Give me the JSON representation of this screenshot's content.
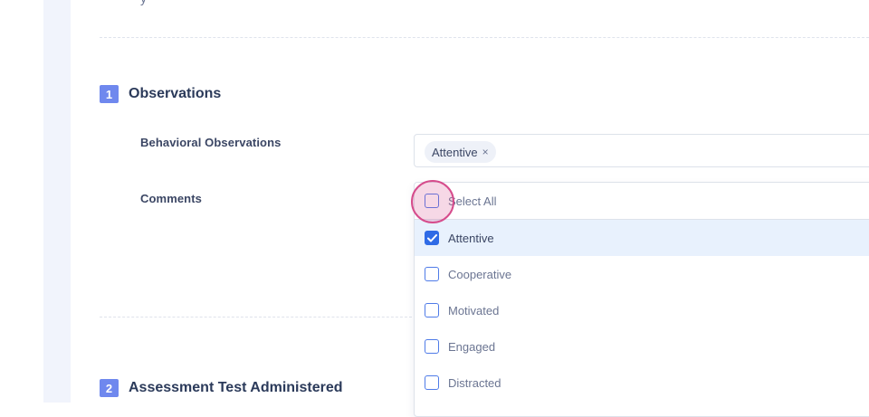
{
  "top_cut_text": "y",
  "sections": [
    {
      "number": "1",
      "title": "Observations"
    },
    {
      "number": "2",
      "title": "Assessment Test Administered"
    }
  ],
  "fields": {
    "behavioral_label": "Behavioral Observations",
    "comments_label": "Comments"
  },
  "multiselect": {
    "selected_chips": [
      "Attentive"
    ],
    "chip_remove_glyph": "×"
  },
  "dropdown": {
    "select_all_label": "Select All",
    "options": [
      {
        "label": "Attentive",
        "checked": true
      },
      {
        "label": "Cooperative",
        "checked": false
      },
      {
        "label": "Motivated",
        "checked": false
      },
      {
        "label": "Engaged",
        "checked": false
      },
      {
        "label": "Distracted",
        "checked": false
      }
    ]
  },
  "colors": {
    "accent": "#6f88ee",
    "checkbox": "#2f6be6",
    "selected_row": "#e8f1fd",
    "click_indicator": "#d64c8c"
  }
}
